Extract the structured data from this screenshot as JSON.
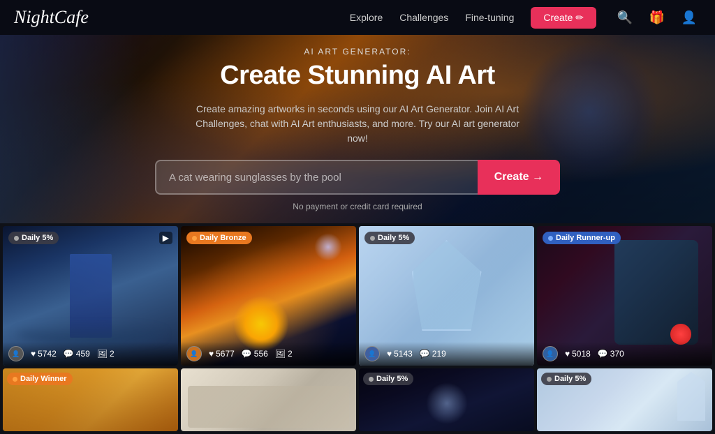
{
  "brand": {
    "name": "NightCafe"
  },
  "navbar": {
    "links": [
      {
        "label": "Explore",
        "id": "explore"
      },
      {
        "label": "Challenges",
        "id": "challenges"
      },
      {
        "label": "Fine-tuning",
        "id": "fine-tuning"
      }
    ],
    "create_label": "Create ✏",
    "search_title": "search",
    "gift_title": "gift",
    "profile_title": "profile"
  },
  "hero": {
    "subtitle": "AI ART GENERATOR:",
    "title": "Create Stunning AI Art",
    "description": "Create amazing artworks in seconds using our AI Art Generator. Join AI Art Challenges, chat with AI Art enthusiasts, and more. Try our AI art generator now!",
    "input_placeholder": "A cat wearing sunglasses by the pool",
    "input_value": "",
    "create_label": "Create →",
    "note": "No payment or credit card required"
  },
  "gallery": {
    "row1": [
      {
        "id": "g1",
        "badge_text": "Daily 5%",
        "badge_type": "grey",
        "has_video": true,
        "likes": "5742",
        "comments": "459",
        "images": "2",
        "bg": "gi-1"
      },
      {
        "id": "g2",
        "badge_text": "Daily Bronze",
        "badge_type": "orange",
        "has_video": false,
        "likes": "5677",
        "comments": "556",
        "images": "2",
        "bg": "gi-2"
      },
      {
        "id": "g3",
        "badge_text": "Daily 5%",
        "badge_type": "grey",
        "has_video": false,
        "likes": "5143",
        "comments": "219",
        "images": "",
        "bg": "gi-3"
      },
      {
        "id": "g4",
        "badge_text": "Daily Runner-up",
        "badge_type": "blue",
        "has_video": false,
        "likes": "5018",
        "comments": "370",
        "images": "",
        "bg": "gi-4"
      }
    ],
    "row2": [
      {
        "id": "g5",
        "badge_text": "Daily Winner",
        "badge_type": "orange",
        "bg": "gi-5"
      },
      {
        "id": "g6",
        "badge_text": "",
        "badge_type": "",
        "bg": "gi-6"
      },
      {
        "id": "g7",
        "badge_text": "Daily 5%",
        "badge_type": "grey",
        "bg": "gi-7"
      },
      {
        "id": "g8",
        "badge_text": "Daily 5%",
        "badge_type": "grey",
        "bg": "gi-8"
      }
    ]
  },
  "icons": {
    "heart": "♥",
    "comment": "💬",
    "image": "🖼",
    "video": "▶",
    "search": "🔍",
    "gift": "🎁",
    "pencil": "✏"
  }
}
